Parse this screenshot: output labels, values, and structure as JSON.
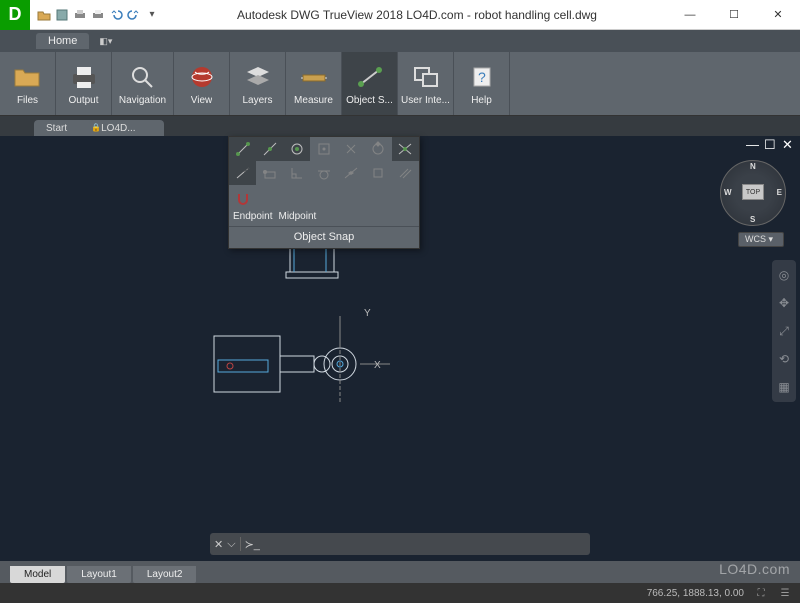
{
  "window": {
    "app_title": "Autodesk DWG TrueView 2018     LO4D.com - robot handling cell.dwg",
    "minimize": "—",
    "maximize": "☐",
    "close": "✕"
  },
  "qat": {
    "items": [
      "open-icon",
      "dwg-icon",
      "print-icon",
      "publish-icon",
      "undo-icon",
      "redo-icon"
    ]
  },
  "menubar": {
    "home": "Home"
  },
  "ribbon": {
    "files": "Files",
    "output": "Output",
    "navigation": "Navigation",
    "view": "View",
    "layers": "Layers",
    "measure": "Measure",
    "object_snap": "Object S...",
    "user_interface": "User Inte...",
    "help": "Help"
  },
  "doc_tabs": {
    "start": "Start",
    "file": "LO4D..."
  },
  "snap_panel": {
    "endpoint": "Endpoint",
    "midpoint": "Midpoint",
    "title": "Object Snap"
  },
  "viewcube": {
    "top": "TOP",
    "n": "N",
    "s": "S",
    "e": "E",
    "w": "W",
    "wcs": "WCS"
  },
  "axes": {
    "x": "X",
    "y": "Y"
  },
  "command": {
    "placeholder": ""
  },
  "bottom_tabs": {
    "model": "Model",
    "layout1": "Layout1",
    "layout2": "Layout2"
  },
  "status": {
    "coords": "766.25, 1888.13, 0.00"
  },
  "watermark": "LO4D.com"
}
